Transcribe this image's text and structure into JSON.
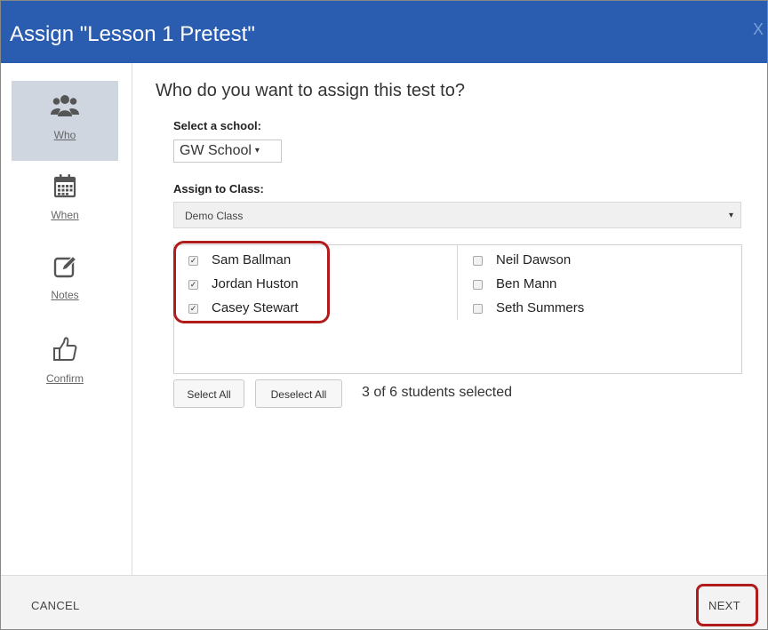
{
  "title": "Assign \"Lesson 1 Pretest\"",
  "close_label": "X",
  "sidebar": {
    "items": [
      {
        "label": "Who",
        "icon": "users-icon",
        "active": true
      },
      {
        "label": "When",
        "icon": "calendar-icon",
        "active": false
      },
      {
        "label": "Notes",
        "icon": "edit-icon",
        "active": false
      },
      {
        "label": "Confirm",
        "icon": "thumbs-up-icon",
        "active": false
      }
    ]
  },
  "main": {
    "question": "Who do you want to assign this test to?",
    "school": {
      "label": "Select a school:",
      "value": "GW School",
      "caret": "▾"
    },
    "class": {
      "label": "Assign to Class:",
      "value": "Demo Class",
      "caret": "▾"
    },
    "students": {
      "left": [
        {
          "name": "Sam Ballman",
          "checked": true
        },
        {
          "name": "Jordan Huston",
          "checked": true
        },
        {
          "name": "Casey Stewart",
          "checked": true
        }
      ],
      "right": [
        {
          "name": "Neil Dawson",
          "checked": false
        },
        {
          "name": "Ben Mann",
          "checked": false
        },
        {
          "name": "Seth Summers",
          "checked": false
        }
      ]
    },
    "select_all_label": "Select All",
    "deselect_all_label": "Deselect All",
    "selected_count_text": "3 of 6 students selected"
  },
  "footer": {
    "cancel_label": "CANCEL",
    "next_label": "NEXT"
  },
  "colors": {
    "header": "#2a5db0",
    "active_nav": "#cfd6e0",
    "highlight": "#b01c1c",
    "icon": "#555555"
  }
}
